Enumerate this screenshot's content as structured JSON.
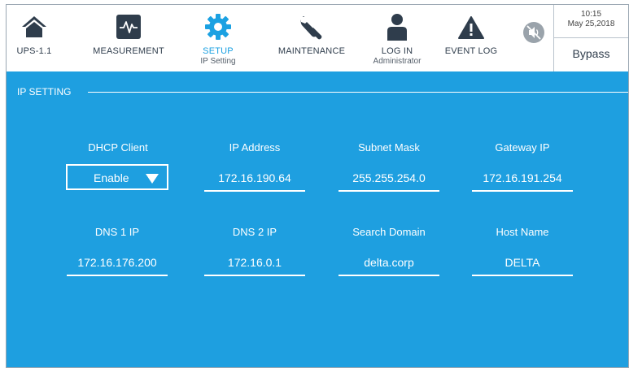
{
  "nav": {
    "items": [
      {
        "label": "UPS-1.1",
        "sublabel": ""
      },
      {
        "label": "MEASUREMENT",
        "sublabel": ""
      },
      {
        "label": "SETUP",
        "sublabel": "IP Setting"
      },
      {
        "label": "MAINTENANCE",
        "sublabel": ""
      },
      {
        "label": "LOG IN",
        "sublabel": "Administrator"
      },
      {
        "label": "EVENT LOG",
        "sublabel": ""
      }
    ],
    "active_index": 2
  },
  "status": {
    "time": "10:15",
    "date": "May 25,2018",
    "mode": "Bypass"
  },
  "section": {
    "title": "IP SETTING"
  },
  "fields": {
    "dhcp": {
      "label": "DHCP Client",
      "value": "Enable"
    },
    "ip": {
      "label": "IP Address",
      "value": "172.16.190.64"
    },
    "subnet": {
      "label": "Subnet Mask",
      "value": "255.255.254.0"
    },
    "gateway": {
      "label": "Gateway IP",
      "value": "172.16.191.254"
    },
    "dns1": {
      "label": "DNS 1 IP",
      "value": "172.16.176.200"
    },
    "dns2": {
      "label": "DNS 2 IP",
      "value": "172.16.0.1"
    },
    "domain": {
      "label": "Search Domain",
      "value": "delta.corp"
    },
    "host": {
      "label": "Host Name",
      "value": "DELTA"
    }
  },
  "icons": [
    "home-icon",
    "measurement-icon",
    "gear-icon",
    "wrench-icon",
    "user-icon",
    "warning-icon",
    "mute-icon"
  ],
  "colors": {
    "accent": "#1ba1e2",
    "panel": "#1e9fe0",
    "icon_dark": "#2f3d4c"
  }
}
